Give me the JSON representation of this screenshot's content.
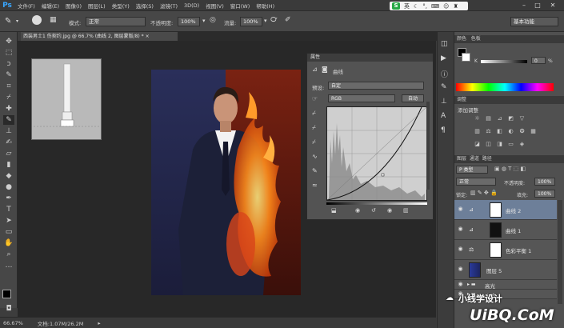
{
  "app": {
    "logo": "Ps"
  },
  "menu": [
    "文件(F)",
    "编辑(E)",
    "图像(I)",
    "图层(L)",
    "类型(Y)",
    "选择(S)",
    "滤镜(T)",
    "3D(D)",
    "视图(V)",
    "窗口(W)",
    "帮助(H)"
  ],
  "ime": {
    "label": "S",
    "lang": "英"
  },
  "window": {
    "minimize": "–",
    "maximize": "□",
    "close": "✕"
  },
  "options": {
    "mode_label": "模式:",
    "mode_value": "正常",
    "opacity_label": "不透明度:",
    "opacity_value": "100%",
    "flow_label": "流量:",
    "flow_value": "100%",
    "workspace": "基本功能"
  },
  "document": {
    "tab_title": "西装男士1 伤契约.jpg @ 66.7% (曲线 2, 图层蒙版/8) *",
    "tab_close": "×"
  },
  "status": {
    "zoom": "66.67%",
    "doc": "文档:1.07M/26.2M"
  },
  "properties": {
    "tab": "属性",
    "title": "曲线",
    "preset_label": "预设:",
    "preset_value": "自定",
    "channel_value": "RGB",
    "auto_button": "自动"
  },
  "color_panel": {
    "tabs": [
      "颜色",
      "色板"
    ],
    "value": "0",
    "unit": "%"
  },
  "adjust_panel": {
    "tab": "调整",
    "subtitle": "添加调整"
  },
  "layers_panel": {
    "tabs": [
      "图层",
      "通道",
      "路径"
    ],
    "kind_label": "P 类型",
    "blend_value": "正常",
    "opacity_label": "不透明度:",
    "opacity_value": "100%",
    "lock_label": "锁定:",
    "fill_label": "填充:",
    "fill_value": "100%",
    "layers": [
      {
        "name": "曲线 2",
        "selected": true
      },
      {
        "name": "曲线 1",
        "selected": false
      },
      {
        "name": "色彩平衡 1",
        "selected": false
      },
      {
        "name": "图层 5",
        "selected": false
      },
      {
        "name": "高光",
        "selected": false
      },
      {
        "name": "火焰",
        "selected": false
      }
    ]
  },
  "watermark": {
    "text": "小线学设计",
    "site": "UiBQ.CoM"
  },
  "colors": {
    "accent": "#39a7ff",
    "selected": "#6d7f99",
    "ime_green": "#27a846"
  }
}
